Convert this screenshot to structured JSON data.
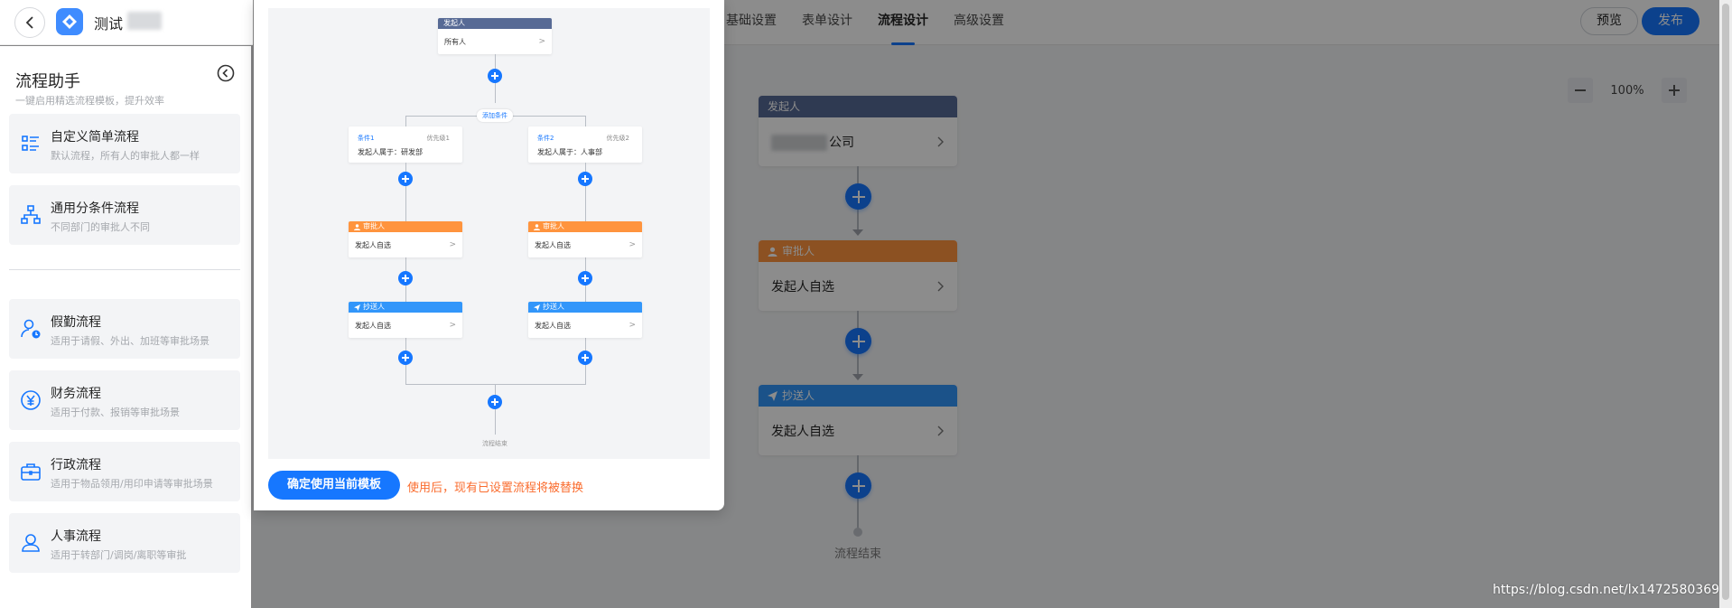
{
  "header": {
    "app_name": "测试",
    "tabs": [
      "基础设置",
      "表单设计",
      "流程设计",
      "高级设置"
    ],
    "preview_label": "预览",
    "publish_label": "发布"
  },
  "canvas": {
    "zoom": "100%",
    "starter": {
      "title": "发起人",
      "value_suffix": "公司"
    },
    "approver": {
      "title": "审批人",
      "value": "发起人自选"
    },
    "cc": {
      "title": "抄送人",
      "value": "发起人自选"
    },
    "end_label": "流程结束",
    "watermark": "https://blog.csdn.net/lx1472580369"
  },
  "assistant": {
    "title": "流程助手",
    "subtitle": "一键启用精选流程模板，提升效率",
    "templates": [
      {
        "title": "自定义简单流程",
        "desc": "默认流程，所有人的审批人都一样"
      },
      {
        "title": "通用分条件流程",
        "desc": "不同部门的审批人不同"
      },
      {
        "title": "假勤流程",
        "desc": "适用于请假、外出、加班等审批场景"
      },
      {
        "title": "财务流程",
        "desc": "适用于付款、报销等审批场景"
      },
      {
        "title": "行政流程",
        "desc": "适用于物品领用/用印申请等审批场景"
      },
      {
        "title": "人事流程",
        "desc": "适用于转部门/调岗/离职等审批"
      }
    ]
  },
  "preview": {
    "starter_title": "发起人",
    "starter_value": "所有人",
    "add_condition": "添加条件",
    "branches": [
      {
        "cond_name": "条件1",
        "priority": "优先级1",
        "cond_value": "发起人属于：研发部",
        "approver_title": "审批人",
        "approver_value": "发起人自选",
        "cc_title": "抄送人",
        "cc_value": "发起人自选"
      },
      {
        "cond_name": "条件2",
        "priority": "优先级2",
        "cond_value": "发起人属于：人事部",
        "approver_title": "审批人",
        "approver_value": "发起人自选",
        "cc_title": "抄送人",
        "cc_value": "发起人自选"
      }
    ],
    "end_label": "流程结束",
    "confirm_label": "确定使用当前模板",
    "warning": "使用后，现有已设置流程将被替换"
  },
  "colors": {
    "primary": "#1677ff",
    "starter": "#576a95",
    "approver": "#ff943e",
    "cc": "#3296fa",
    "warning": "#fa6c2e"
  }
}
